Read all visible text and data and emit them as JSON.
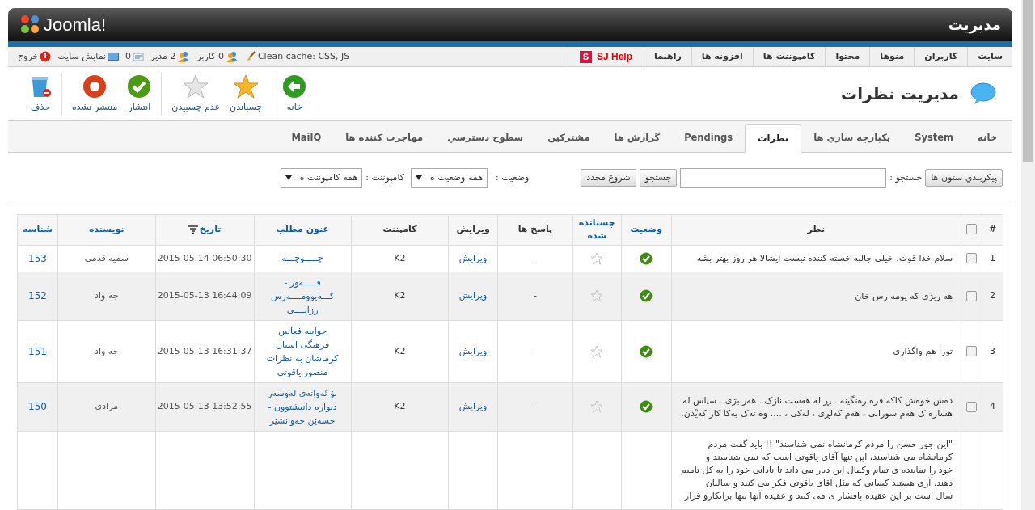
{
  "header": {
    "logo": "Joomla!",
    "title": "مدیریت"
  },
  "menu": [
    {
      "label": "سایت",
      "kind": "menu"
    },
    {
      "label": "کاربران",
      "kind": "menu"
    },
    {
      "label": "منوها",
      "kind": "menu"
    },
    {
      "label": "محتوا",
      "kind": "menu"
    },
    {
      "label": "کامپوننت ها",
      "kind": "menu"
    },
    {
      "label": "افزونه ها",
      "kind": "menu"
    },
    {
      "label": "راهنما",
      "kind": "menu"
    },
    {
      "label": "SJ Help",
      "kind": "help",
      "badge": "S"
    }
  ],
  "status": [
    {
      "label": "Clean cache: CSS, JS",
      "kind": "cache"
    },
    {
      "label": "0 کاربر",
      "kind": "users"
    },
    {
      "label": "2 مدیر",
      "kind": "admins"
    },
    {
      "label": "0",
      "kind": "messages"
    },
    {
      "label": "نمایش سایت",
      "kind": "site"
    },
    {
      "label": "خروج",
      "kind": "logout"
    }
  ],
  "page_title": "مدیریت نظرات",
  "toolbar": [
    {
      "buttons": [
        {
          "label": "خانه",
          "kind": "back"
        }
      ]
    },
    {
      "buttons": [
        {
          "label": "چسباندن",
          "kind": "feature"
        },
        {
          "label": "عدم چسبیدن",
          "kind": "unfeature"
        }
      ]
    },
    {
      "buttons": [
        {
          "label": "انتشار",
          "kind": "publish"
        },
        {
          "label": "منتشر نشده",
          "kind": "unpublish"
        }
      ]
    },
    {
      "buttons": [
        {
          "label": "حذف",
          "kind": "trash"
        }
      ]
    }
  ],
  "tabs": [
    {
      "label": "خانه",
      "selected": false
    },
    {
      "label": "System",
      "selected": false
    },
    {
      "label": "يكپارچه سازي ها",
      "selected": false
    },
    {
      "label": "نظرات",
      "selected": true
    },
    {
      "label": "Pendings",
      "selected": false
    },
    {
      "label": "گزارش ها",
      "selected": false
    },
    {
      "label": "مشتركين",
      "selected": false
    },
    {
      "label": "سطوح دسترسي",
      "selected": false
    },
    {
      "label": "مهاجرت كننده ها",
      "selected": false
    },
    {
      "label": "MailQ",
      "selected": false
    }
  ],
  "filters": {
    "columns_button": "پیکربندي ستون ها",
    "search_label": "جستجو :",
    "search_button": "جستجو",
    "reset_button": "شروع مجدد",
    "state_label": "وضعیت :",
    "state_value": "همه وضعیت ه",
    "component_label": "کامپوننت :",
    "component_value": "همه کامپوننت ه"
  },
  "table": {
    "columns": [
      {
        "label": "#",
        "kind": "text"
      },
      {
        "kind": "checkbox",
        "checked": false
      },
      {
        "label": "نظر",
        "kind": "text"
      },
      {
        "label": "وضعیت",
        "kind": "link"
      },
      {
        "label": "چسبانده شده",
        "kind": "link"
      },
      {
        "label": "پاسخ ها",
        "kind": "text"
      },
      {
        "label": "ویرایش",
        "kind": "text"
      },
      {
        "label": "کامپننت",
        "kind": "text"
      },
      {
        "label": "عنون مطلب",
        "kind": "link"
      },
      {
        "label": "تاریخ",
        "kind": "link",
        "sorted": true
      },
      {
        "label": "نویسنده",
        "kind": "link"
      },
      {
        "label": "شناسه",
        "kind": "link"
      }
    ],
    "rows": [
      {
        "num": "1",
        "checked": false,
        "comment": "سلام خدا قوت. خیلی جالبه خسته کننده نیست ایشالا هر روز بهتر بشه",
        "published": true,
        "featured": false,
        "replies": "-",
        "edit": "ویرایش",
        "component": "K2",
        "item": "چـــــوچـــه",
        "date": "2015-05-14 06:50:30",
        "author": "سمیه قدمی",
        "id": "153"
      },
      {
        "num": "2",
        "checked": false,
        "comment": "هه ربژی که یومه رس خان",
        "published": true,
        "featured": false,
        "replies": "-",
        "edit": "ویرایش",
        "component": "K2",
        "item": "قـــــەور - کـــەیوومــــەرس رزایــــی",
        "date": "2015-05-13 16:44:09",
        "author": "جه واد",
        "id": "152"
      },
      {
        "num": "3",
        "checked": false,
        "comment": "تورا هم واگذاری",
        "published": true,
        "featured": false,
        "replies": "-",
        "edit": "ویرایش",
        "component": "K2",
        "item": "جوابیه فعالین فرهنگی استان کرماشان به نظرات منصور یاقوتی",
        "date": "2015-05-13 16:31:37",
        "author": "جه واد",
        "id": "151"
      },
      {
        "num": "4",
        "checked": false,
        "comment": "دەس خوەش کاکه فره رەنگینه . پڕ لە هەست نازک . هەر بژی . سپاس لە هساره ک هەم سورانی ، هەم کەلڕی ، لەکی ، .... وه تەک یەکا کار کەیْدن.",
        "published": true,
        "featured": false,
        "replies": "-",
        "edit": "ویرایش",
        "component": "K2",
        "item": "بۆ ئەوانەی لەوسەر دیوارە دانیشتوون - حسەێن جەوانشێر",
        "date": "2015-05-13 13:52:55",
        "author": "مرادی",
        "id": "150"
      },
      {
        "num": "",
        "checked": null,
        "comment": "\"این جور حسن را مردم کرمانشاه نمی شناسند\" !! باید گفت مردم\nکرمانشاه می شناسند، این تنها آقای یاقوتی است که نمی شناسند و\nخود را نماینده ی تمام وکمال این دیار می داند تا نادانی خود را به کل تامیم\nدهند. آری هستند کسانی که مثل آقای یاقوتی فکر می کنند و سالیان\nسال است بر این عقیده پافشار ی می کنند و عقیده آنها تنها برانکارو قرار",
        "published": null,
        "featured": null,
        "replies": "",
        "edit": "",
        "component": "",
        "item": "",
        "date": "",
        "author": "",
        "id": ""
      }
    ]
  }
}
